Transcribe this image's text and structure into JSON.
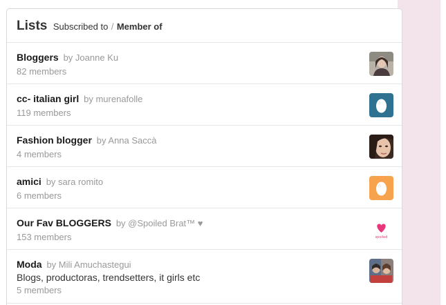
{
  "header": {
    "title": "Lists",
    "subscribed": "Subscribed to",
    "separator": "/",
    "member_of": "Member of"
  },
  "lists": [
    {
      "name": "Bloggers",
      "by": "by Joanne Ku",
      "members": "82 members",
      "description": "",
      "avatar": "portrait-photo"
    },
    {
      "name": "cc- italian girl",
      "by": "by murenafolle",
      "members": "119 members",
      "description": "",
      "avatar": "egg-icon"
    },
    {
      "name": "Fashion blogger",
      "by": "by Anna Saccà",
      "members": "4 members",
      "description": "",
      "avatar": "portrait-photo"
    },
    {
      "name": "amici",
      "by": "by sara romito",
      "members": "6 members",
      "description": "",
      "avatar": "egg-icon"
    },
    {
      "name": "Our Fav BLOGGERS",
      "by": "by @Spoiled Brat™ ♥",
      "members": "153 members",
      "description": "",
      "avatar": "heart-logo"
    },
    {
      "name": "Moda",
      "by": "by Mili Amuchastegui",
      "members": "5 members",
      "description": "Blogs, productoras, trendsetters, it girls etc",
      "avatar": "photo"
    }
  ],
  "colors": {
    "egg_teal": "#2e7190",
    "egg_orange": "#f7a34d",
    "heart_pink": "#e8367a",
    "background_pink": "#f3e4ec"
  },
  "logo_text": "spoiled"
}
